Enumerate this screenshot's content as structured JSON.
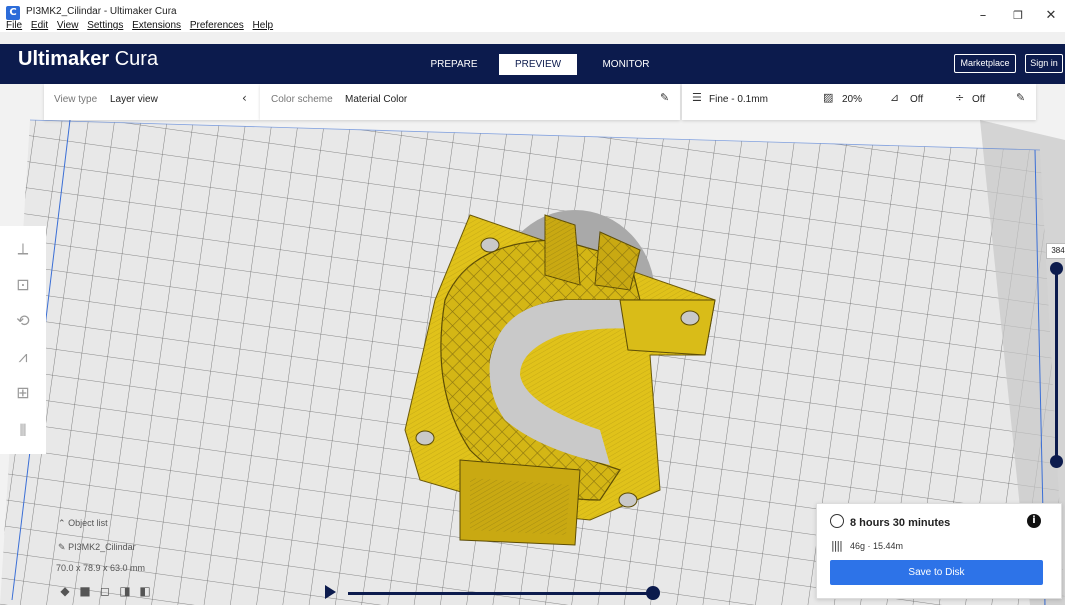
{
  "window": {
    "title": "PI3MK2_Cilindar - Ultimaker Cura",
    "menu": [
      "File",
      "Edit",
      "View",
      "Settings",
      "Extensions",
      "Preferences",
      "Help"
    ],
    "controls": {
      "minimize": "–",
      "maximize": "❐",
      "close": "✕"
    }
  },
  "header": {
    "logo_bold": "Ultimaker",
    "logo_light": " Cura",
    "stages": [
      {
        "label": "PREPARE",
        "active": false
      },
      {
        "label": "PREVIEW",
        "active": true
      },
      {
        "label": "MONITOR",
        "active": false
      }
    ],
    "marketplace_label": "Marketplace",
    "signin_label": "Sign in"
  },
  "toolbar": {
    "view_type_label": "View type",
    "view_type_value": "Layer view",
    "color_scheme_label": "Color scheme",
    "color_scheme_value": "Material Color",
    "profile": "Fine - 0.1mm",
    "infill": "20%",
    "support": "Off",
    "adhesion": "Off"
  },
  "layer_slider": {
    "current_layer": "384"
  },
  "object": {
    "list_label": "Object list",
    "name": "PI3MK2_Cilindar",
    "dimensions": "70.0 x 78.9 x 63.0 mm"
  },
  "print_info": {
    "time": "8 hours 30 minutes",
    "material": "46g · 15.44m",
    "save_label": "Save to Disk"
  },
  "colors": {
    "header_bg": "#0c1b4d",
    "model_yellow": "#e0c21a",
    "accent_blue": "#2d73e8"
  }
}
